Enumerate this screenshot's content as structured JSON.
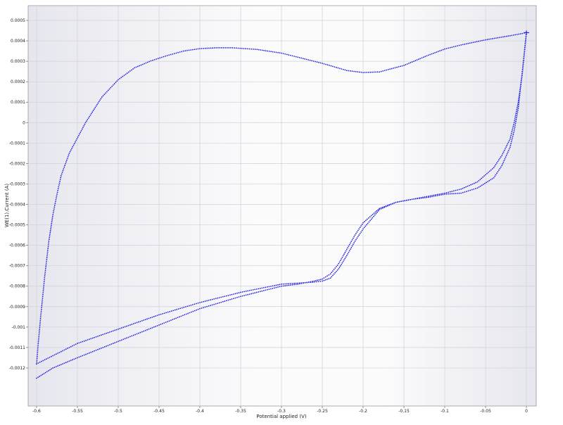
{
  "chart_data": {
    "type": "scatter",
    "xlabel": "Potential applied (V)",
    "ylabel": "WE(1).Current (A)",
    "xlim": [
      -0.6,
      0.0
    ],
    "ylim": [
      -0.0013,
      0.0005
    ],
    "x_ticks": [
      "-0.6",
      "-0.55",
      "-0.5",
      "-0.45",
      "-0.4",
      "-0.35",
      "-0.3",
      "-0.25",
      "-0.2",
      "-0.15",
      "-0.1",
      "-0.05",
      "0"
    ],
    "y_ticks": [
      "0.0005",
      "0.0004",
      "0.0003",
      "0.0002",
      "0.0001",
      "0",
      "-0.0001",
      "-0.0002",
      "-0.0003",
      "-0.0004",
      "-0.0005",
      "-0.0006",
      "-0.0007",
      "-0.0008",
      "-0.0009",
      "-0.001",
      "-0.0011",
      "-0.0012"
    ],
    "grid": true,
    "marker_color": "#2020e0",
    "series": [
      {
        "x": [
          0.0,
          -0.005,
          -0.02,
          -0.05,
          -0.08,
          -0.1,
          -0.12,
          -0.15,
          -0.18,
          -0.2,
          -0.22,
          -0.25,
          -0.28,
          -0.3,
          -0.33,
          -0.36,
          -0.38,
          -0.4,
          -0.42,
          -0.44,
          -0.46,
          -0.48,
          -0.5,
          -0.52,
          -0.54,
          -0.56,
          -0.57,
          -0.575,
          -0.58,
          -0.585,
          -0.59,
          -0.595,
          -0.598,
          -0.6
        ],
        "y": [
          0.00044,
          0.000436,
          0.000425,
          0.000405,
          0.00038,
          0.00036,
          0.00033,
          0.00028,
          0.000248,
          0.000245,
          0.000255,
          0.00029,
          0.00032,
          0.00034,
          0.000358,
          0.000366,
          0.000366,
          0.000362,
          0.00035,
          0.000328,
          0.000302,
          0.000268,
          0.00021,
          0.000125,
          0.0,
          -0.00015,
          -0.00026,
          -0.00035,
          -0.00045,
          -0.00058,
          -0.00075,
          -0.00095,
          -0.00108,
          -0.00118
        ]
      },
      {
        "x": [
          -0.6,
          -0.58,
          -0.55,
          -0.5,
          -0.45,
          -0.4,
          -0.35,
          -0.3,
          -0.28,
          -0.26,
          -0.25,
          -0.24,
          -0.23,
          -0.22,
          -0.21,
          -0.2,
          -0.18,
          -0.16,
          -0.14,
          -0.12,
          -0.1,
          -0.08,
          -0.06,
          -0.04,
          -0.03,
          -0.02,
          -0.015,
          -0.01,
          -0.005,
          0.0
        ],
        "y": [
          -0.00118,
          -0.00114,
          -0.00108,
          -0.00101,
          -0.00094,
          -0.00088,
          -0.00083,
          -0.00079,
          -0.000785,
          -0.00078,
          -0.000775,
          -0.00076,
          -0.000715,
          -0.00065,
          -0.00058,
          -0.00052,
          -0.000425,
          -0.00039,
          -0.000375,
          -0.00036,
          -0.000345,
          -0.000325,
          -0.00029,
          -0.00022,
          -0.00016,
          -8e-05,
          0.0,
          0.0001,
          0.00024,
          0.00044
        ]
      },
      {
        "x": [
          0.0,
          -0.005,
          -0.01,
          -0.015,
          -0.02,
          -0.03,
          -0.04,
          -0.06,
          -0.08,
          -0.1,
          -0.12,
          -0.14,
          -0.16,
          -0.18,
          -0.2,
          -0.21,
          -0.22,
          -0.23,
          -0.24,
          -0.25,
          -0.26,
          -0.28,
          -0.3,
          -0.35,
          -0.4,
          -0.45,
          -0.5,
          -0.55,
          -0.58,
          -0.6
        ],
        "y": [
          0.00044,
          0.00025,
          7e-05,
          -4e-05,
          -0.00012,
          -0.00021,
          -0.00027,
          -0.00032,
          -0.000345,
          -0.00035,
          -0.000365,
          -0.000375,
          -0.00039,
          -0.00042,
          -0.00049,
          -0.00055,
          -0.00062,
          -0.00069,
          -0.00074,
          -0.000765,
          -0.000775,
          -0.00079,
          -0.0008,
          -0.00085,
          -0.00091,
          -0.00099,
          -0.00107,
          -0.00115,
          -0.0012,
          -0.00125
        ]
      }
    ]
  }
}
